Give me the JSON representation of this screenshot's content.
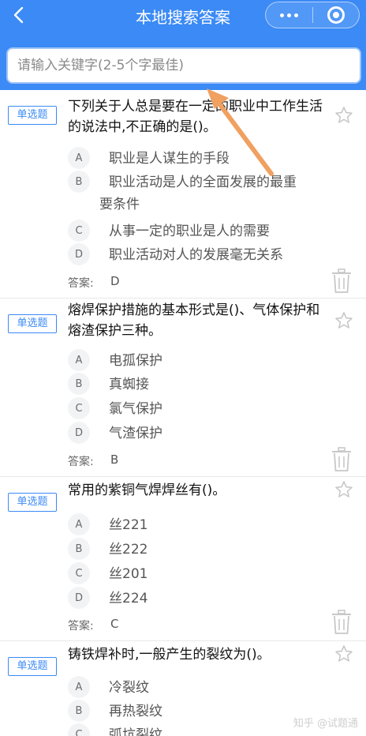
{
  "nav": {
    "title": "本地搜索答案"
  },
  "search": {
    "placeholder": "请输入关键字(2-5个字最佳)",
    "value": ""
  },
  "questions": [
    {
      "type": "单选题",
      "text": "下列关于人总是要在一定的职业中工作生活的说法中,不正确的是()。",
      "options": [
        {
          "letter": "A",
          "text": "职业是人谋生的手段"
        },
        {
          "letter": "B",
          "text": "职业活动是人的全面发展的最重",
          "text2": "要条件"
        },
        {
          "letter": "C",
          "text": "从事一定的职业是人的需要"
        },
        {
          "letter": "D",
          "text": "职业活动对人的发展毫无关系"
        }
      ],
      "answer_label": "答案:",
      "answer": "D"
    },
    {
      "type": "单选题",
      "text": "熔焊保护措施的基本形式是()、气体保护和熔渣保护三种。",
      "options": [
        {
          "letter": "A",
          "text": "电孤保护"
        },
        {
          "letter": "B",
          "text": "真蜘接"
        },
        {
          "letter": "C",
          "text": "氯气保护"
        },
        {
          "letter": "D",
          "text": "气渣保护"
        }
      ],
      "answer_label": "答案:",
      "answer": "B"
    },
    {
      "type": "单选题",
      "text": "常用的紫铜气焊焊丝有()。",
      "options": [
        {
          "letter": "A",
          "text": "丝221"
        },
        {
          "letter": "B",
          "text": "丝222"
        },
        {
          "letter": "C",
          "text": "丝201"
        },
        {
          "letter": "D",
          "text": "丝224"
        }
      ],
      "answer_label": "答案:",
      "answer": "C"
    },
    {
      "type": "单选题",
      "text": "铸铁焊补时,一般产生的裂纹为()。",
      "options": [
        {
          "letter": "A",
          "text": "冷裂纹"
        },
        {
          "letter": "B",
          "text": "再热裂纹"
        },
        {
          "letter": "C",
          "text": "弧坑裂纹"
        }
      ]
    }
  ],
  "watermark": "知乎 @试题通",
  "colors": {
    "header": "#3b8af5",
    "accent": "#3b8af5",
    "arrow": "#f0a060"
  }
}
